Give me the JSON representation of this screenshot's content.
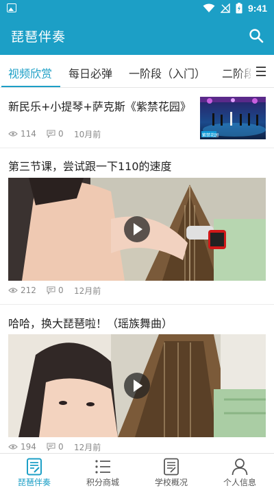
{
  "status_bar": {
    "time": "9:41"
  },
  "app_bar": {
    "title": "琵琶伴奏"
  },
  "tabs": [
    {
      "label": "视频欣赏",
      "active": true
    },
    {
      "label": "每日必弹",
      "active": false
    },
    {
      "label": "一阶段（入门）",
      "active": false
    },
    {
      "label": "二阶段",
      "active": false
    }
  ],
  "feed": [
    {
      "title": "新民乐+小提琴+萨克斯《紫禁花园》",
      "views": "114",
      "comments": "0",
      "time": "10月前",
      "thumb_caption": "紫禁花园"
    },
    {
      "title": "第三节课，尝试跟一下110的速度",
      "views": "212",
      "comments": "0",
      "time": "12月前"
    },
    {
      "title": "哈哈，换大琵琶啦！（瑶族舞曲）",
      "views": "194",
      "comments": "0",
      "time": "12月前"
    }
  ],
  "bottom_nav": [
    {
      "label": "琵琶伴奏",
      "icon": "doc-edit-icon",
      "active": true
    },
    {
      "label": "积分商城",
      "icon": "list-icon",
      "active": false
    },
    {
      "label": "学校概况",
      "icon": "document-icon",
      "active": false
    },
    {
      "label": "个人信息",
      "icon": "person-icon",
      "active": false
    }
  ],
  "colors": {
    "primary": "#1c9fc6",
    "meta_text": "#888888"
  }
}
